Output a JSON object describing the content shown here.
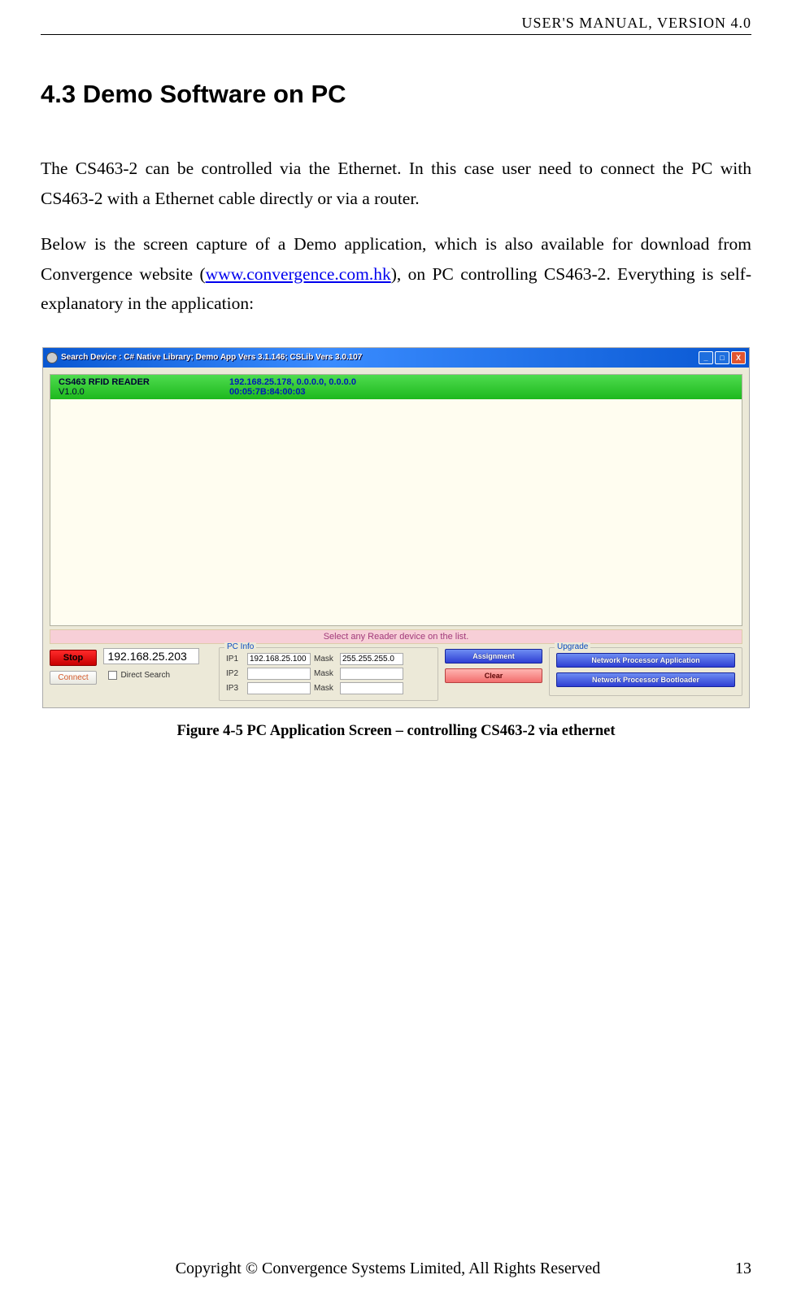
{
  "header": "USER'S  MANUAL,  VERSION  4.0",
  "section_title": "4.3 Demo Software on PC",
  "para1": "The CS463-2 can be controlled via the Ethernet.    In this case user need to connect the PC with CS463-2 with a Ethernet cable directly or via a router.",
  "para2a": "Below is the screen capture of a Demo application, which is also available for download from Convergence website (",
  "para2_link": "www.convergence.com.hk",
  "para2b": "), on PC controlling CS463-2.    Everything is self-explanatory in the application:",
  "window": {
    "title": "Search Device : C# Native Library; Demo App Vers 3.1.146; CSLib Vers 3.0.107",
    "device": {
      "name": "CS463 RFID READER",
      "version": "V1.0.0",
      "ips": "192.168.25.178, 0.0.0.0, 0.0.0.0",
      "mac": "00:05:7B:84:00:03"
    },
    "instruction": "Select any Reader device on the list.",
    "stop": "Stop",
    "ip_display": "192.168.25.203",
    "connect": "Connect",
    "direct_search": "Direct Search",
    "pcinfo": {
      "legend": "PC Info",
      "rows": [
        {
          "iplbl": "IP1",
          "ip": "192.168.25.100",
          "masklbl": "Mask",
          "mask": "255.255.255.0"
        },
        {
          "iplbl": "IP2",
          "ip": "",
          "masklbl": "Mask",
          "mask": ""
        },
        {
          "iplbl": "IP3",
          "ip": "",
          "masklbl": "Mask",
          "mask": ""
        }
      ]
    },
    "assignment": "Assignment",
    "clear": "Clear",
    "upgrade": {
      "legend": "Upgrade",
      "btn1": "Network Processor Application",
      "btn2": "Network Processor Bootloader"
    }
  },
  "figure": {
    "num": "Figure 4-5",
    "caption": " PC Application Screen – controlling CS463-2 via ethernet"
  },
  "footer": {
    "copyright": "Copyright © Convergence Systems Limited, All Rights Reserved",
    "page": "13"
  }
}
